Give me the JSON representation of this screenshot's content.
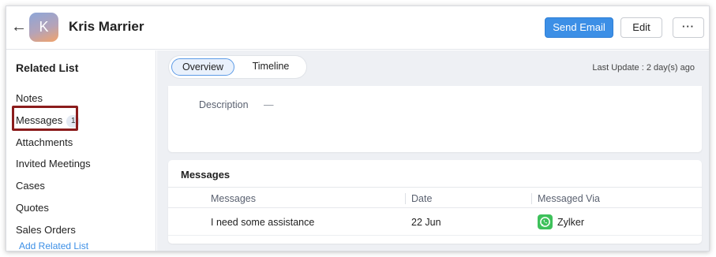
{
  "header": {
    "contact_name": "Kris Marrier",
    "avatar_initial": "K",
    "send_email_label": "Send Email",
    "edit_label": "Edit",
    "more_label": "···"
  },
  "sidebar": {
    "title": "Related List",
    "items": [
      {
        "label": "Notes"
      },
      {
        "label": "Messages",
        "badge": "1"
      },
      {
        "label": "Attachments"
      },
      {
        "label": "Invited Meetings"
      },
      {
        "label": "Cases"
      },
      {
        "label": "Quotes"
      },
      {
        "label": "Sales Orders"
      }
    ],
    "add_link": "Add Related List"
  },
  "main": {
    "tabs": [
      {
        "label": "Overview",
        "active": true
      },
      {
        "label": "Timeline",
        "active": false
      }
    ],
    "last_update": "Last Update : 2 day(s) ago",
    "description": {
      "label": "Description",
      "value": "—"
    },
    "messages_section": {
      "title": "Messages",
      "columns": [
        "Messages",
        "Date",
        "Messaged Via"
      ],
      "rows": [
        {
          "message": "I need some assistance",
          "date": "22 Jun",
          "via": "Zylker",
          "via_icon": "whatsapp-icon"
        }
      ]
    }
  },
  "colors": {
    "primary": "#3c8fe6",
    "highlight_border": "#8b1c1c",
    "whatsapp": "#3ec15b"
  }
}
